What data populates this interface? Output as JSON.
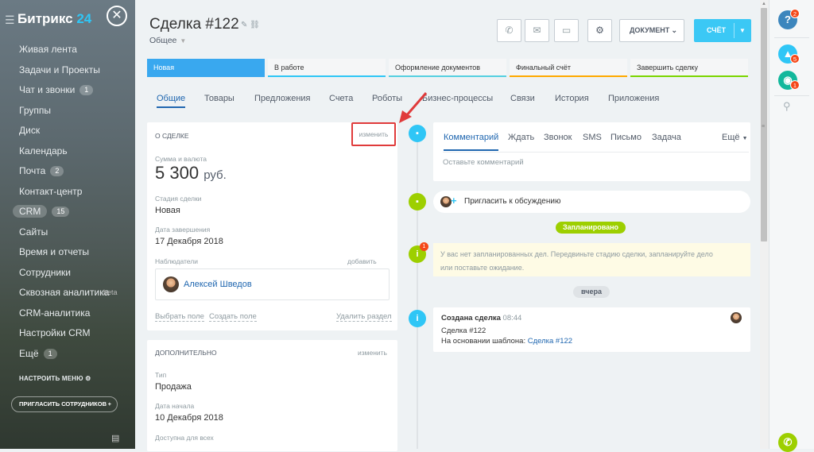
{
  "sidebar": {
    "logo": "Битрикс",
    "logo_num": "24",
    "items": [
      {
        "label": "Живая лента"
      },
      {
        "label": "Задачи и Проекты"
      },
      {
        "label": "Чат и звонки",
        "count": "1"
      },
      {
        "label": "Группы"
      },
      {
        "label": "Диск"
      },
      {
        "label": "Календарь"
      },
      {
        "label": "Почта",
        "count": "2"
      },
      {
        "label": "Контакт-центр"
      },
      {
        "label": "CRM",
        "count": "15"
      },
      {
        "label": "Сайты"
      },
      {
        "label": "Время и отчеты"
      },
      {
        "label": "Сотрудники"
      },
      {
        "label": "Сквозная аналитика",
        "extra": "beta"
      },
      {
        "label": "CRM-аналитика"
      },
      {
        "label": "Настройки CRM"
      },
      {
        "label": "Ещё",
        "count": "1"
      }
    ],
    "config_menu": "НАСТРОИТЬ МЕНЮ",
    "invite": "ПРИГЛАСИТЬ СОТРУДНИКОВ"
  },
  "header": {
    "title": "Сделка #122",
    "subtitle": "Общее",
    "document_btn": "ДОКУМЕНТ",
    "invoice_btn": "СЧЁТ"
  },
  "stages": [
    {
      "label": "Новая",
      "color": "#39a8ef"
    },
    {
      "label": "В работе",
      "color": "#2fc6f6"
    },
    {
      "label": "Оформление документов",
      "color": "#55d0e0"
    },
    {
      "label": "Финальный счёт",
      "color": "#ffa900"
    },
    {
      "label": "Завершить сделку",
      "color": "#7bd500"
    }
  ],
  "tabs": [
    "Общие",
    "Товары",
    "Предложения",
    "Счета",
    "Роботы",
    "Бизнес-процессы",
    "Связи",
    "История",
    "Приложения"
  ],
  "about": {
    "head": "О СДЕЛКЕ",
    "edit": "изменить",
    "amount_label": "Сумма и валюта",
    "amount": "5 300",
    "currency": "руб.",
    "stage_label": "Стадия сделки",
    "stage": "Новая",
    "close_label": "Дата завершения",
    "close_date": "17 Декабря 2018",
    "observers_label": "Наблюдатели",
    "add": "добавить",
    "observer": "Алексей Шведов",
    "choose_field": "Выбрать поле",
    "create_field": "Создать поле",
    "delete_section": "Удалить раздел"
  },
  "extra": {
    "head": "ДОПОЛНИТЕЛЬНО",
    "edit": "изменить",
    "type_label": "Тип",
    "type": "Продажа",
    "start_label": "Дата начала",
    "start_date": "10 Декабря 2018",
    "avail_label": "Доступна для всех"
  },
  "timeline": {
    "tabs": [
      "Комментарий",
      "Ждать",
      "Звонок",
      "SMS",
      "Письмо",
      "Задача"
    ],
    "more": "Ещё",
    "comment_placeholder": "Оставьте комментарий",
    "invite": "Пригласить к обсуждению",
    "planned": "Запланировано",
    "empty_text_1": "У вас нет запланированных дел. Передвиньте стадию сделки, запланируйте дело",
    "empty_text_2": "или поставьте ожидание.",
    "yesterday": "вчера",
    "created_title": "Создана сделка",
    "created_time": "08:44",
    "created_line1": "Сделка #122",
    "created_line2_prefix": "На основании шаблона:",
    "created_link": "Сделка #122",
    "info_badge": "1"
  },
  "rightbar": {
    "help_badge": "2",
    "notify_badge": "5",
    "chat_badge": "1"
  }
}
